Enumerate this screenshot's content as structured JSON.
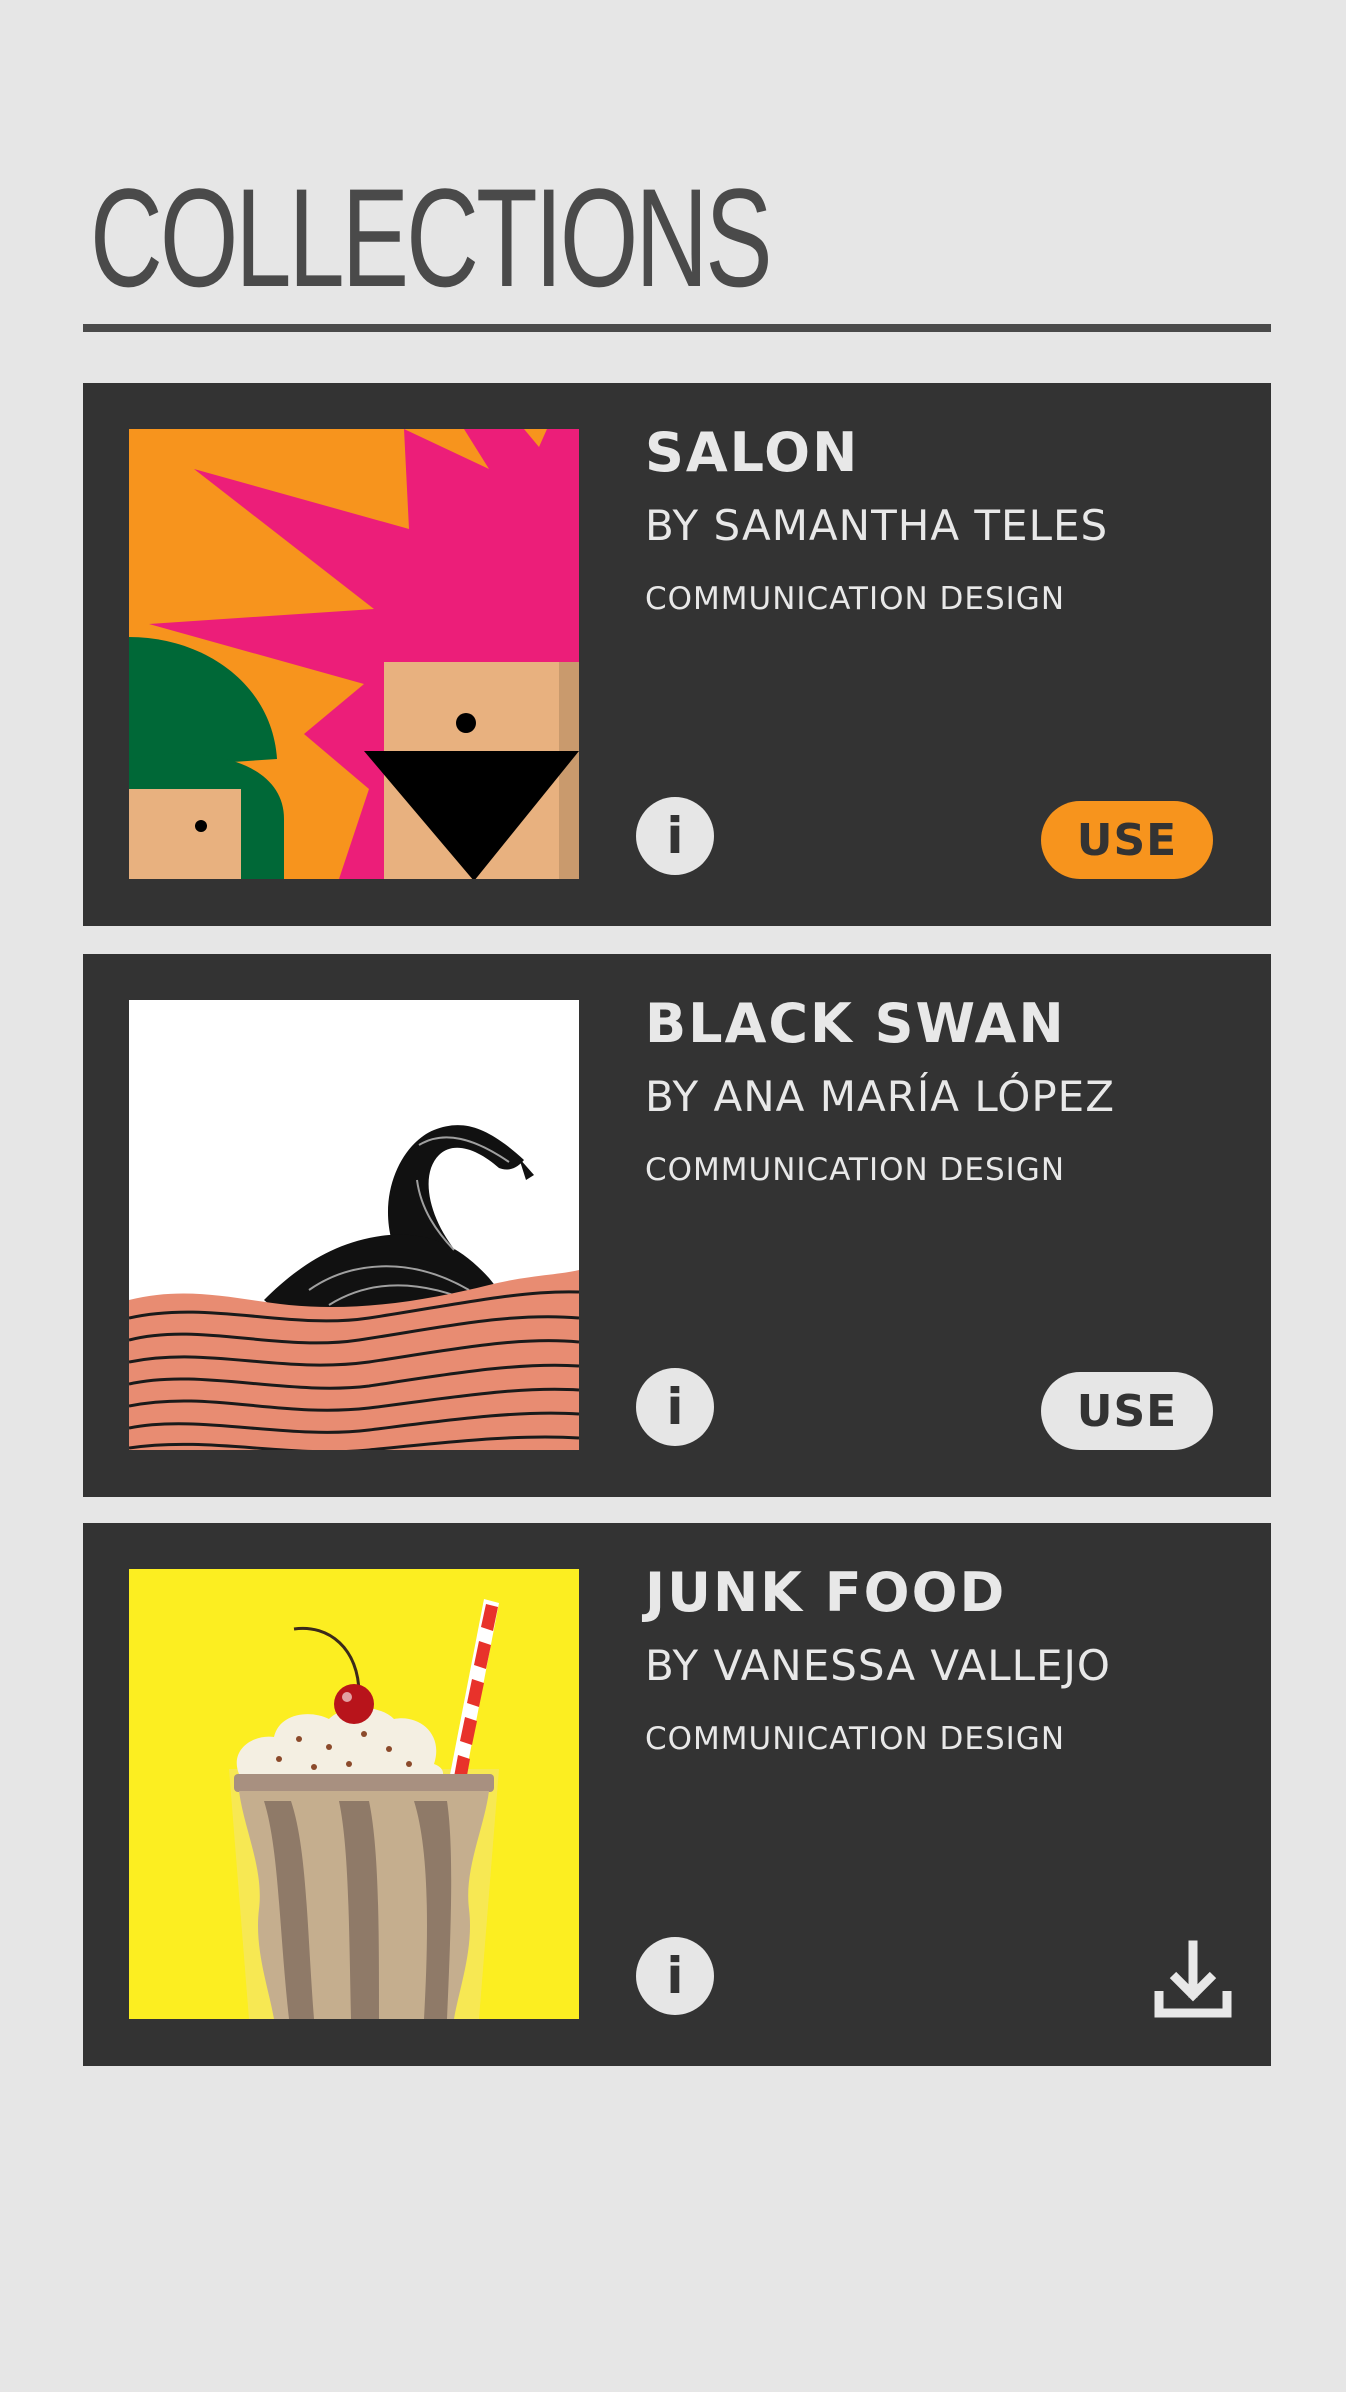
{
  "page": {
    "title": "COLLECTIONS"
  },
  "collections": [
    {
      "name": "SALON",
      "author": "BY SAMANTHA TELES",
      "category": "COMMUNICATION DESIGN",
      "action": "use",
      "action_label": "USE",
      "action_color": "#f7941d",
      "info_label": "i",
      "thumbnail_icon": "salon-artwork"
    },
    {
      "name": "BLACK SWAN",
      "author": "BY ANA MARÍA LÓPEZ",
      "category": "COMMUNICATION DESIGN",
      "action": "use",
      "action_label": "USE",
      "action_color": "#e6e6e6",
      "info_label": "i",
      "thumbnail_icon": "black-swan-artwork"
    },
    {
      "name": "JUNK FOOD",
      "author": "BY VANESSA VALLEJO",
      "category": "COMMUNICATION DESIGN",
      "action": "download",
      "action_icon": "download-icon",
      "info_label": "i",
      "thumbnail_icon": "junk-food-artwork"
    }
  ],
  "colors": {
    "background": "#e6e6e6",
    "card": "#333333",
    "title": "#4a4a4a",
    "accent": "#f7941d"
  }
}
